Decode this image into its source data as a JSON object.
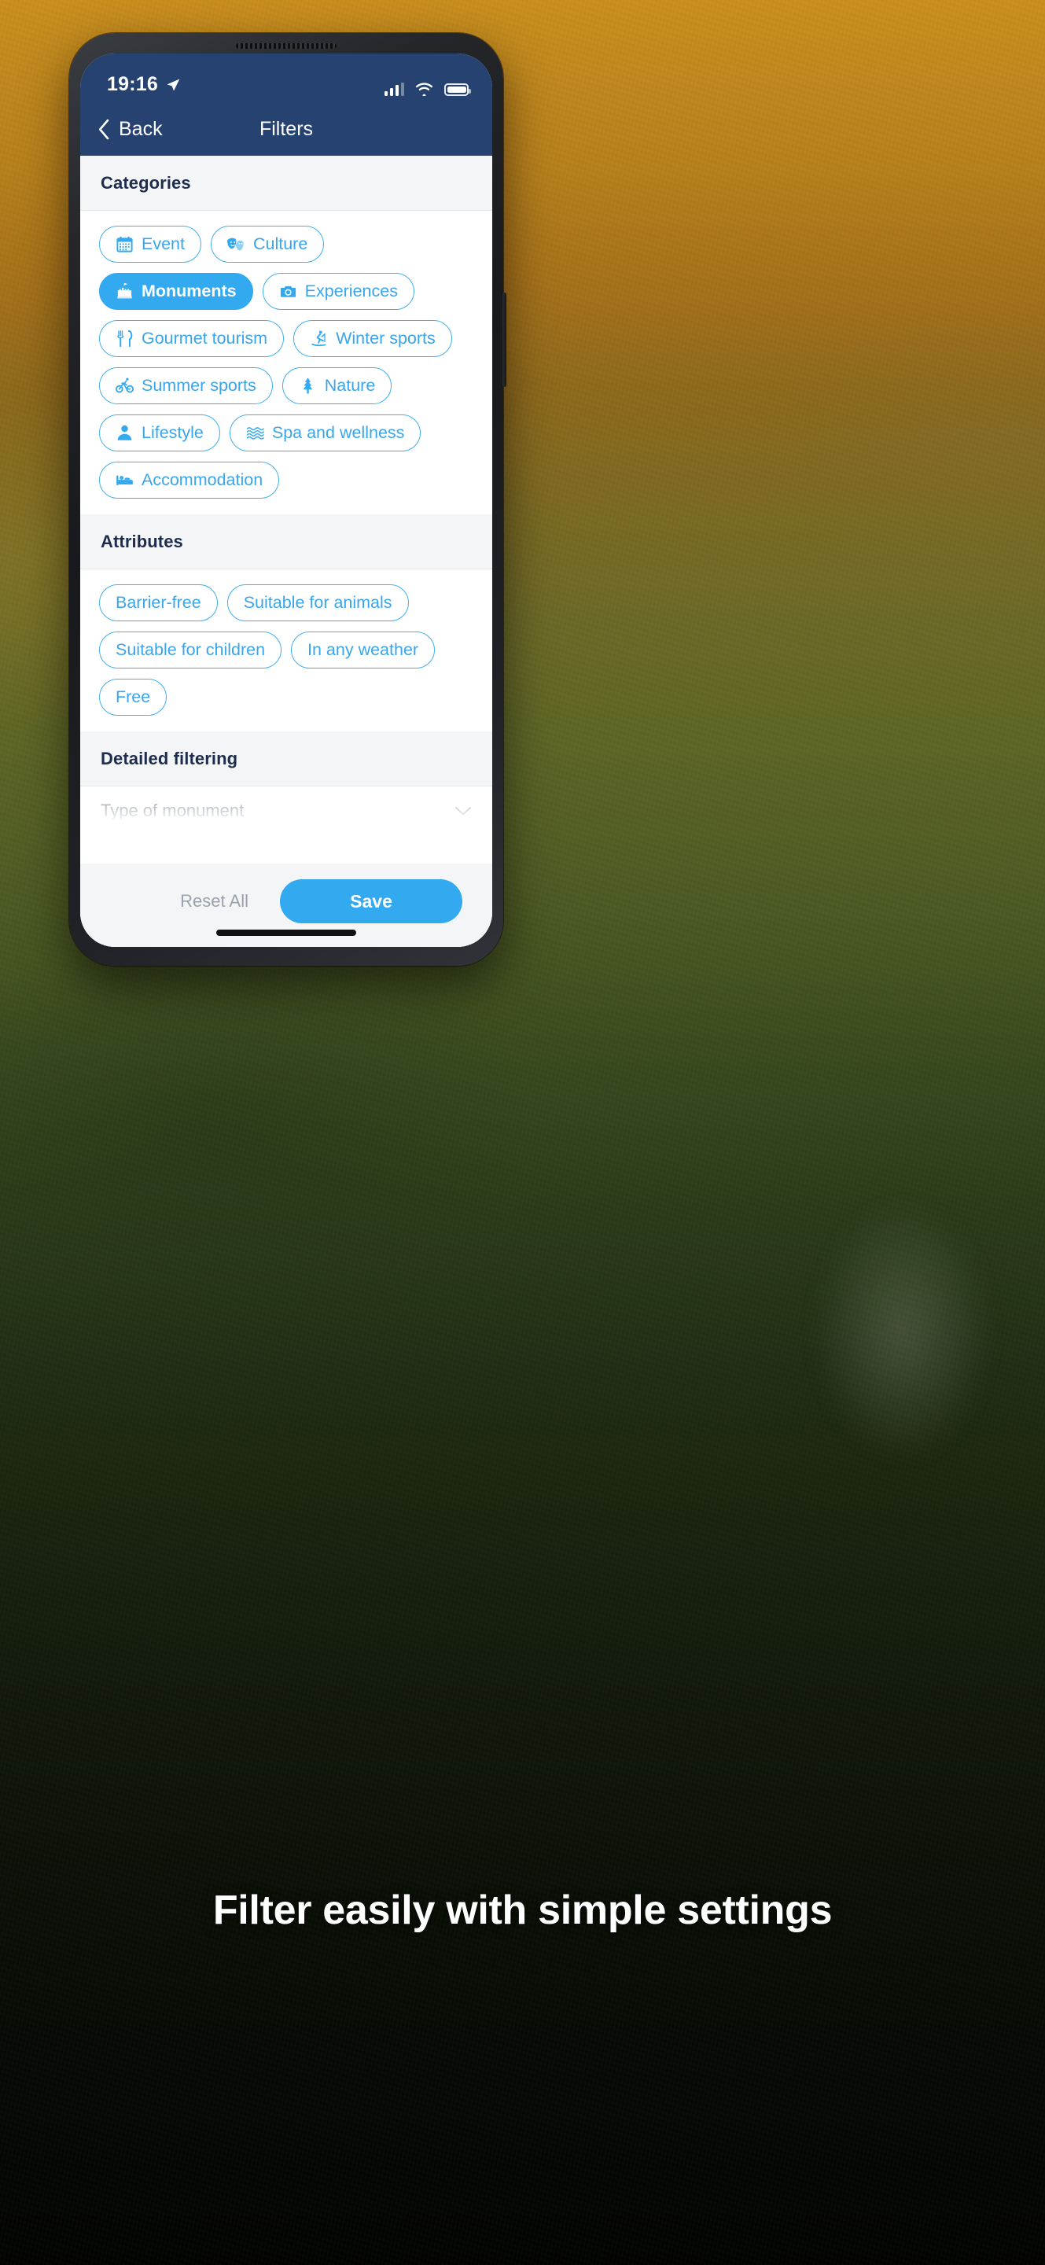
{
  "statusbar": {
    "time": "19:16",
    "location_icon": "location-arrow-icon",
    "signal_icon": "cellular-signal-icon",
    "wifi_icon": "wifi-icon",
    "battery_icon": "battery-full-icon"
  },
  "navbar": {
    "back_label": "Back",
    "back_icon": "chevron-left-icon",
    "title": "Filters"
  },
  "sections": {
    "categories_title": "Categories",
    "attributes_title": "Attributes",
    "detailed_title": "Detailed filtering"
  },
  "categories": [
    {
      "label": "Event",
      "icon": "calendar-icon",
      "selected": false
    },
    {
      "label": "Culture",
      "icon": "masks-icon",
      "selected": false
    },
    {
      "label": "Monuments",
      "icon": "castle-icon",
      "selected": true
    },
    {
      "label": "Experiences",
      "icon": "camera-icon",
      "selected": false
    },
    {
      "label": "Gourmet tourism",
      "icon": "cutlery-icon",
      "selected": false
    },
    {
      "label": "Winter sports",
      "icon": "skier-icon",
      "selected": false
    },
    {
      "label": "Summer sports",
      "icon": "bicycle-icon",
      "selected": false
    },
    {
      "label": "Nature",
      "icon": "tree-icon",
      "selected": false
    },
    {
      "label": "Lifestyle",
      "icon": "person-icon",
      "selected": false
    },
    {
      "label": "Spa and wellness",
      "icon": "waves-icon",
      "selected": false
    },
    {
      "label": "Accommodation",
      "icon": "bed-icon",
      "selected": false
    }
  ],
  "attributes": [
    {
      "label": "Barrier-free",
      "selected": false
    },
    {
      "label": "Suitable for animals",
      "selected": false
    },
    {
      "label": "Suitable for children",
      "selected": false
    },
    {
      "label": "In any weather",
      "selected": false
    },
    {
      "label": "Free",
      "selected": false
    }
  ],
  "detailed": {
    "dropdown_placeholder": "Type of monument",
    "dropdown_icon": "chevron-down-icon"
  },
  "actions": {
    "reset_label": "Reset All",
    "save_label": "Save"
  },
  "caption": {
    "text": "Filter easily with simple settings"
  },
  "colors": {
    "header_blue": "#264270",
    "accent_blue": "#33aaf0",
    "chip_border": "#41afee",
    "section_bg": "#f4f5f7",
    "muted_text": "#9aa2ad",
    "heading_text": "#1e2d4d"
  }
}
